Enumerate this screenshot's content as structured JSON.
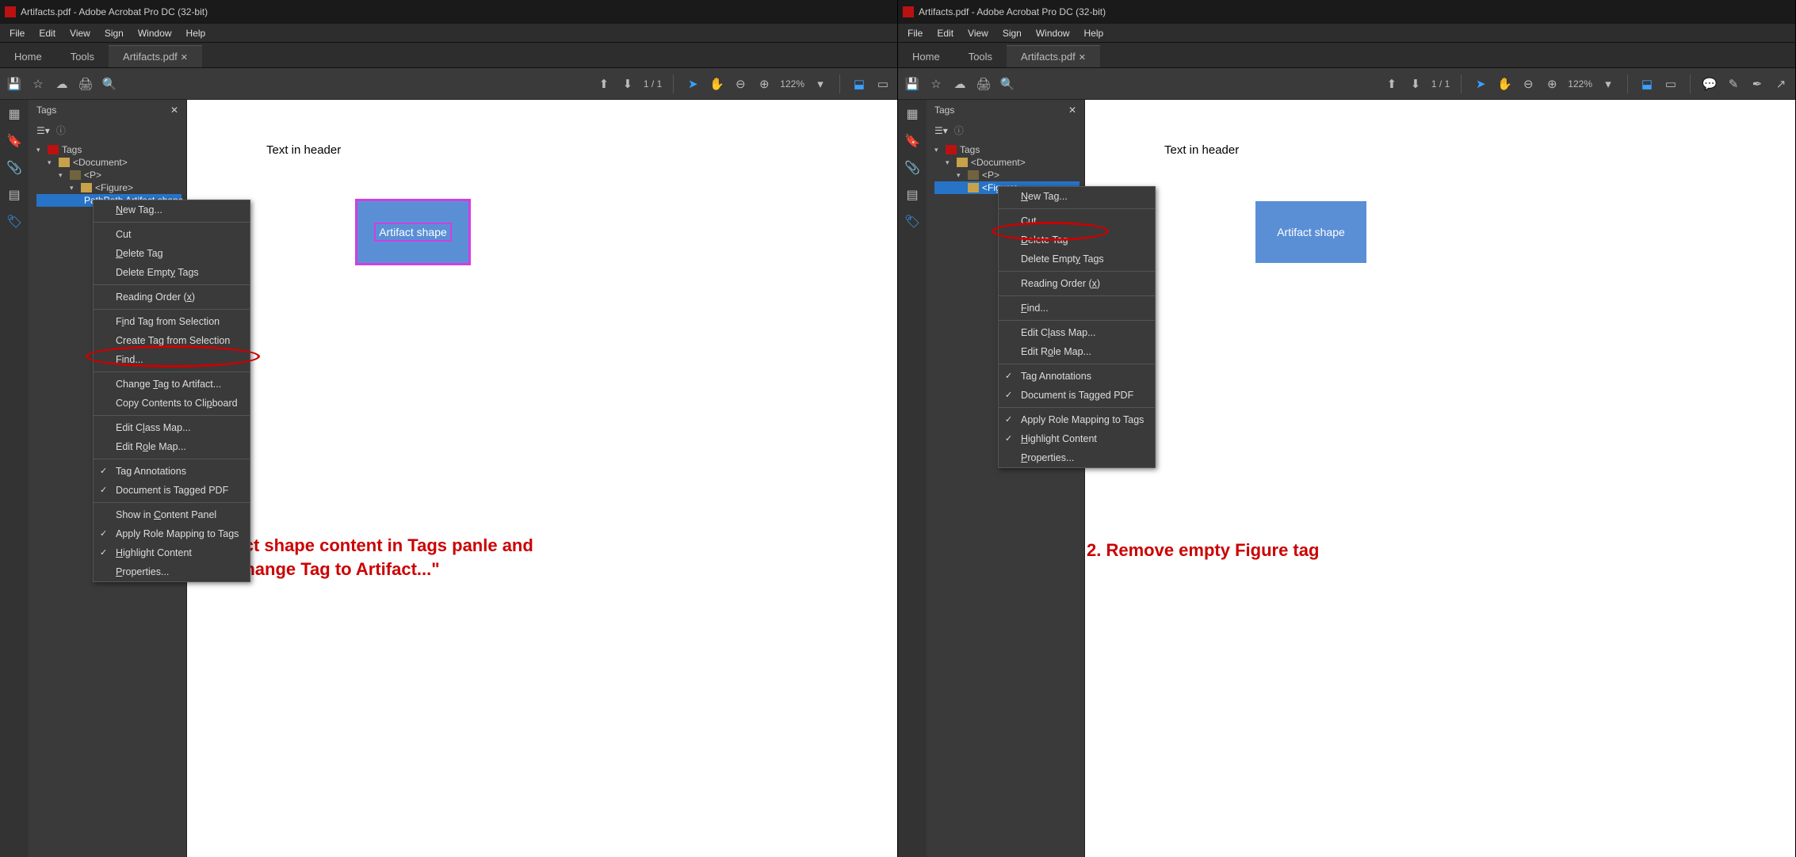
{
  "title": "Artifacts.pdf - Adobe Acrobat Pro DC (32-bit)",
  "menu": [
    "File",
    "Edit",
    "View",
    "Sign",
    "Window",
    "Help"
  ],
  "tabs": {
    "home": "Home",
    "tools": "Tools",
    "doc": "Artifacts.pdf"
  },
  "page_indicator": {
    "current": "1",
    "sep": "/",
    "total": "1"
  },
  "zoom": "122%",
  "tagspanel": {
    "title": "Tags",
    "root": "Tags",
    "document": "<Document>",
    "p": "<P>",
    "figure": "<Figure>",
    "content": "PathPath Artifact shape"
  },
  "doc": {
    "header": "Text in header",
    "shape": "Artifact shape"
  },
  "ctx_left": {
    "new_tag": "New Tag...",
    "cut": "Cut",
    "delete_tag": "Delete Tag",
    "delete_empty": "Delete Empty Tags",
    "reading_order": "Reading Order (x)",
    "find_tag_sel": "Find Tag from Selection",
    "create_tag_sel": "Create Tag from Selection",
    "find": "Find...",
    "change_artifact": "Change Tag to Artifact...",
    "copy_clip": "Copy Contents to Clipboard",
    "edit_class": "Edit Class Map...",
    "edit_role": "Edit Role Map...",
    "tag_annot": "Tag Annotations",
    "tagged_pdf": "Document is Tagged PDF",
    "show_content": "Show in Content Panel",
    "apply_role": "Apply Role Mapping to Tags",
    "highlight": "Highlight Content",
    "props": "Properties..."
  },
  "ctx_right": {
    "new_tag": "New Tag...",
    "cut": "Cut",
    "delete_tag": "Delete Tag",
    "delete_empty": "Delete Empty Tags",
    "reading_order": "Reading Order (x)",
    "find": "Find...",
    "edit_class": "Edit Class Map...",
    "edit_role": "Edit Role Map...",
    "tag_annot": "Tag Annotations",
    "tagged_pdf": "Document is Tagged PDF",
    "apply_role": "Apply Role Mapping to Tags",
    "highlight": "Highlight Content",
    "props": "Properties..."
  },
  "captions": {
    "left": "1. Select shape content in Tags panle and use \"Change Tag to Artifact...\"",
    "right": "2. Remove empty Figure tag"
  }
}
